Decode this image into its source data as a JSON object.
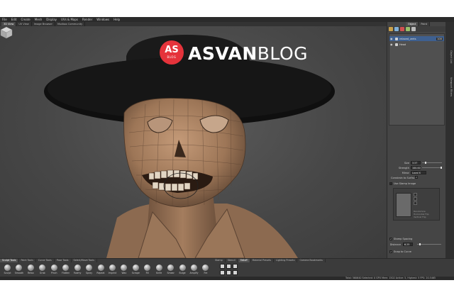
{
  "menu": [
    "File",
    "Edit",
    "Create",
    "Mesh",
    "Display",
    "UVs & Maps",
    "Render",
    "Windows",
    "Help"
  ],
  "view_tabs": [
    "3D View",
    "UV View",
    "Image Browser",
    "Mudbox Community"
  ],
  "watermark": {
    "badge_main": "AS",
    "badge_sub": "BLOG",
    "word_bold": "ASVAN",
    "word_light": "BLOG"
  },
  "right_panel": {
    "tabs": [
      "Object",
      "Paint"
    ],
    "outliner": [
      {
        "name": "relaxed_verts",
        "value": "100",
        "selected": true
      },
      {
        "name": "Head",
        "value": "",
        "selected": false
      }
    ],
    "props": {
      "size_label": "Size",
      "size_value": "3.57",
      "strength_label": "Strength",
      "strength_value": "100.00",
      "mirror_label": "Mirror",
      "mirror_value": "Local X",
      "constrain_label": "Constrain to Surface",
      "use_stamp_label": "Use Stamp Image",
      "stamp_opt1": "Randomize",
      "stamp_opt2": "Horizontal Flip",
      "stamp_opt3": "Vertical Flip",
      "stamp_spacing_label": "Stamp Spacing",
      "distance_label": "Distance",
      "distance_value": "6.25",
      "snap_label": "Snap to Curve"
    }
  },
  "side_tabs": [
    "Object List",
    "Viewport Filters"
  ],
  "bottom": {
    "left_tabs": [
      "Sculpt Tools",
      "Paint Tools",
      "Curve Tools",
      "Pose Tools",
      "Select/Move Tools"
    ],
    "right_tabs": [
      "Stamp",
      "Stencil",
      "Falloff",
      "Material Presets",
      "Lighting Presets",
      "Camera Bookmarks"
    ],
    "brushes": [
      "Sculpt",
      "Smooth",
      "Relax",
      "Grab",
      "Pinch",
      "Flatten",
      "Foamy",
      "Spray",
      "Repeat",
      "Imprint",
      "Wax",
      "Scrape",
      "Fill",
      "Knife",
      "Smear",
      "Bulge",
      "Amplify",
      "Fre"
    ]
  },
  "status": "Total: 560640  Selected: 0 GPU Mem: 1502  Active: 5, Highest: 5  FPS: 20.5465",
  "colors": {
    "accent_red": "#e5333b",
    "selection_blue": "#3e6090",
    "skin": "#a98263",
    "hat": "#111111"
  }
}
